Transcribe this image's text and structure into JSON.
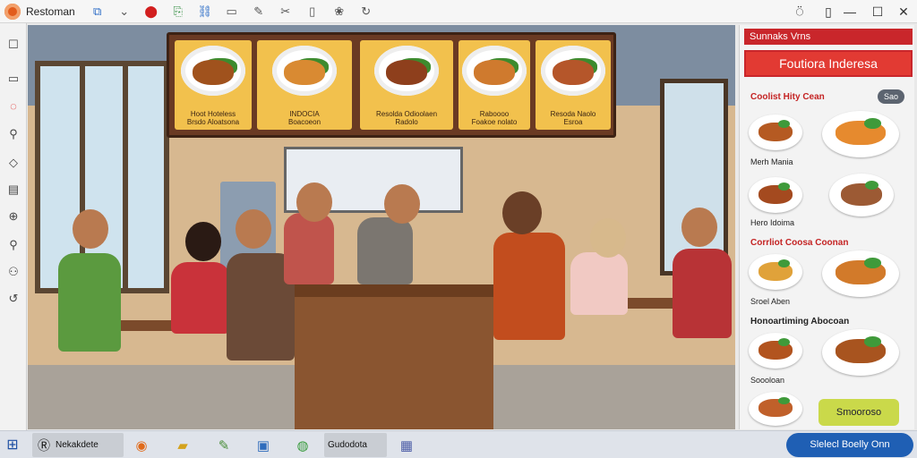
{
  "titlebar": {
    "app_title": "Restoman",
    "tools": [
      "share-icon",
      "chevron-down-icon",
      "stop-icon",
      "export-icon",
      "link-icon",
      "frame-icon",
      "edit-icon",
      "crop-icon",
      "pages-icon",
      "palette-icon",
      "refresh-icon"
    ],
    "window_controls": [
      "help-icon",
      "minimize-icon",
      "maximize-icon",
      "close-icon"
    ]
  },
  "sidebar": {
    "tools": [
      "select-icon",
      "rectangle-icon",
      "lasso-icon",
      "zoom-icon",
      "layer-icon",
      "text-icon",
      "globe-icon",
      "magnifier-icon",
      "figures-icon",
      "rotate-icon"
    ]
  },
  "menu_board": {
    "items": [
      {
        "name_line1": "Hoot Hoteless",
        "name_line2": "Brsdo Aloatsona"
      },
      {
        "name_line1": "INDOCIA",
        "name_line2": "Boacoeon"
      },
      {
        "name_line1": "Resolda Odioolaen",
        "name_line2": "Radolo"
      },
      {
        "name_line1": "Raboooo",
        "name_line2": "Foakoe nolato"
      },
      {
        "name_line1": "Resoda Naolo",
        "name_line2": "Esroa"
      }
    ]
  },
  "panel": {
    "header": "Sunnaks Vrns",
    "title": "Foutiora Inderesa",
    "section1": "Coolist Hity Cean",
    "badge": "Sao",
    "dish_label1": "Merh Mania",
    "dish_label2": "Hero Idoima",
    "section2": "Corrliot Coosa Coonan",
    "dish_label3": "Sroel Aben",
    "section3": "Honoartiming Abocoan",
    "dish_label4": "Soooloan",
    "order_button": "Smooroso"
  },
  "taskbar": {
    "item1": "Nekakdete",
    "item2": "Gudodota",
    "search": "Slelecl Boelly Onn"
  },
  "colors": {
    "accent_red": "#c9262b",
    "menu_board": "#6a3a23",
    "menu_tile": "#f2c14d",
    "order_button": "#cad94a",
    "search_pill": "#1f5fb4"
  }
}
